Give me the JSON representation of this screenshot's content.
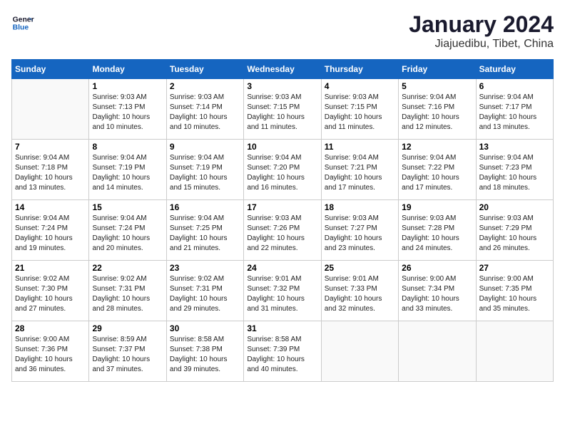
{
  "header": {
    "logo_line1": "General",
    "logo_line2": "Blue",
    "title": "January 2024",
    "subtitle": "Jiajuedibu, Tibet, China"
  },
  "days_of_week": [
    "Sunday",
    "Monday",
    "Tuesday",
    "Wednesday",
    "Thursday",
    "Friday",
    "Saturday"
  ],
  "weeks": [
    [
      {
        "num": "",
        "sunrise": "",
        "sunset": "",
        "daylight": ""
      },
      {
        "num": "1",
        "sunrise": "Sunrise: 9:03 AM",
        "sunset": "Sunset: 7:13 PM",
        "daylight": "Daylight: 10 hours and 10 minutes."
      },
      {
        "num": "2",
        "sunrise": "Sunrise: 9:03 AM",
        "sunset": "Sunset: 7:14 PM",
        "daylight": "Daylight: 10 hours and 10 minutes."
      },
      {
        "num": "3",
        "sunrise": "Sunrise: 9:03 AM",
        "sunset": "Sunset: 7:15 PM",
        "daylight": "Daylight: 10 hours and 11 minutes."
      },
      {
        "num": "4",
        "sunrise": "Sunrise: 9:03 AM",
        "sunset": "Sunset: 7:15 PM",
        "daylight": "Daylight: 10 hours and 11 minutes."
      },
      {
        "num": "5",
        "sunrise": "Sunrise: 9:04 AM",
        "sunset": "Sunset: 7:16 PM",
        "daylight": "Daylight: 10 hours and 12 minutes."
      },
      {
        "num": "6",
        "sunrise": "Sunrise: 9:04 AM",
        "sunset": "Sunset: 7:17 PM",
        "daylight": "Daylight: 10 hours and 13 minutes."
      }
    ],
    [
      {
        "num": "7",
        "sunrise": "Sunrise: 9:04 AM",
        "sunset": "Sunset: 7:18 PM",
        "daylight": "Daylight: 10 hours and 13 minutes."
      },
      {
        "num": "8",
        "sunrise": "Sunrise: 9:04 AM",
        "sunset": "Sunset: 7:19 PM",
        "daylight": "Daylight: 10 hours and 14 minutes."
      },
      {
        "num": "9",
        "sunrise": "Sunrise: 9:04 AM",
        "sunset": "Sunset: 7:19 PM",
        "daylight": "Daylight: 10 hours and 15 minutes."
      },
      {
        "num": "10",
        "sunrise": "Sunrise: 9:04 AM",
        "sunset": "Sunset: 7:20 PM",
        "daylight": "Daylight: 10 hours and 16 minutes."
      },
      {
        "num": "11",
        "sunrise": "Sunrise: 9:04 AM",
        "sunset": "Sunset: 7:21 PM",
        "daylight": "Daylight: 10 hours and 17 minutes."
      },
      {
        "num": "12",
        "sunrise": "Sunrise: 9:04 AM",
        "sunset": "Sunset: 7:22 PM",
        "daylight": "Daylight: 10 hours and 17 minutes."
      },
      {
        "num": "13",
        "sunrise": "Sunrise: 9:04 AM",
        "sunset": "Sunset: 7:23 PM",
        "daylight": "Daylight: 10 hours and 18 minutes."
      }
    ],
    [
      {
        "num": "14",
        "sunrise": "Sunrise: 9:04 AM",
        "sunset": "Sunset: 7:24 PM",
        "daylight": "Daylight: 10 hours and 19 minutes."
      },
      {
        "num": "15",
        "sunrise": "Sunrise: 9:04 AM",
        "sunset": "Sunset: 7:24 PM",
        "daylight": "Daylight: 10 hours and 20 minutes."
      },
      {
        "num": "16",
        "sunrise": "Sunrise: 9:04 AM",
        "sunset": "Sunset: 7:25 PM",
        "daylight": "Daylight: 10 hours and 21 minutes."
      },
      {
        "num": "17",
        "sunrise": "Sunrise: 9:03 AM",
        "sunset": "Sunset: 7:26 PM",
        "daylight": "Daylight: 10 hours and 22 minutes."
      },
      {
        "num": "18",
        "sunrise": "Sunrise: 9:03 AM",
        "sunset": "Sunset: 7:27 PM",
        "daylight": "Daylight: 10 hours and 23 minutes."
      },
      {
        "num": "19",
        "sunrise": "Sunrise: 9:03 AM",
        "sunset": "Sunset: 7:28 PM",
        "daylight": "Daylight: 10 hours and 24 minutes."
      },
      {
        "num": "20",
        "sunrise": "Sunrise: 9:03 AM",
        "sunset": "Sunset: 7:29 PM",
        "daylight": "Daylight: 10 hours and 26 minutes."
      }
    ],
    [
      {
        "num": "21",
        "sunrise": "Sunrise: 9:02 AM",
        "sunset": "Sunset: 7:30 PM",
        "daylight": "Daylight: 10 hours and 27 minutes."
      },
      {
        "num": "22",
        "sunrise": "Sunrise: 9:02 AM",
        "sunset": "Sunset: 7:31 PM",
        "daylight": "Daylight: 10 hours and 28 minutes."
      },
      {
        "num": "23",
        "sunrise": "Sunrise: 9:02 AM",
        "sunset": "Sunset: 7:31 PM",
        "daylight": "Daylight: 10 hours and 29 minutes."
      },
      {
        "num": "24",
        "sunrise": "Sunrise: 9:01 AM",
        "sunset": "Sunset: 7:32 PM",
        "daylight": "Daylight: 10 hours and 31 minutes."
      },
      {
        "num": "25",
        "sunrise": "Sunrise: 9:01 AM",
        "sunset": "Sunset: 7:33 PM",
        "daylight": "Daylight: 10 hours and 32 minutes."
      },
      {
        "num": "26",
        "sunrise": "Sunrise: 9:00 AM",
        "sunset": "Sunset: 7:34 PM",
        "daylight": "Daylight: 10 hours and 33 minutes."
      },
      {
        "num": "27",
        "sunrise": "Sunrise: 9:00 AM",
        "sunset": "Sunset: 7:35 PM",
        "daylight": "Daylight: 10 hours and 35 minutes."
      }
    ],
    [
      {
        "num": "28",
        "sunrise": "Sunrise: 9:00 AM",
        "sunset": "Sunset: 7:36 PM",
        "daylight": "Daylight: 10 hours and 36 minutes."
      },
      {
        "num": "29",
        "sunrise": "Sunrise: 8:59 AM",
        "sunset": "Sunset: 7:37 PM",
        "daylight": "Daylight: 10 hours and 37 minutes."
      },
      {
        "num": "30",
        "sunrise": "Sunrise: 8:58 AM",
        "sunset": "Sunset: 7:38 PM",
        "daylight": "Daylight: 10 hours and 39 minutes."
      },
      {
        "num": "31",
        "sunrise": "Sunrise: 8:58 AM",
        "sunset": "Sunset: 7:39 PM",
        "daylight": "Daylight: 10 hours and 40 minutes."
      },
      {
        "num": "",
        "sunrise": "",
        "sunset": "",
        "daylight": ""
      },
      {
        "num": "",
        "sunrise": "",
        "sunset": "",
        "daylight": ""
      },
      {
        "num": "",
        "sunrise": "",
        "sunset": "",
        "daylight": ""
      }
    ]
  ]
}
